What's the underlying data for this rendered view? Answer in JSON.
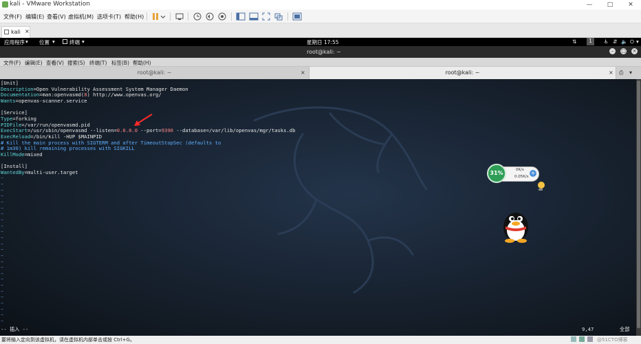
{
  "vmware": {
    "window_title": "kali - VMware Workstation",
    "menus": [
      "文件(F)",
      "编辑(E)",
      "查看(V)",
      "虚拟机(M)",
      "选项卡(T)",
      "帮助(H)"
    ],
    "tab_label": "kali",
    "status_hint": "要将输入定向到该虚拟机，请在虚拟机内部单击或按 Ctrl+G。"
  },
  "kali": {
    "topbar": {
      "applications": "应用程序",
      "places": "位置",
      "terminal": "终端",
      "clock": "星期日 17:55",
      "workspace": "1"
    },
    "terminal_window": {
      "title": "root@kali: ~",
      "menus": [
        "文件(F)",
        "编辑(E)",
        "查看(V)",
        "搜索(S)",
        "终端(T)",
        "标签(B)",
        "帮助(H)"
      ],
      "tabs": [
        "root@kali: ~",
        "root@kali: ~"
      ],
      "tab_close": "×"
    },
    "editor": {
      "lines": [
        {
          "k": "[Unit]",
          "v": ""
        },
        {
          "k": "Description",
          "v": "=Open Vulnerability Assessment System Manager Daemon"
        },
        {
          "k": "Documentation",
          "v": "=man:openvasmd(8) http://www.openvas.org/"
        },
        {
          "k": "Wants",
          "v": "=openvas-scanner.service"
        },
        {
          "k": "",
          "v": ""
        },
        {
          "k": "[Service]",
          "v": ""
        },
        {
          "k": "Type",
          "v": "=forking"
        },
        {
          "k": "PIDFile",
          "v": "=/var/run/openvasmd.pid"
        },
        {
          "k": "ExecStart",
          "v": "=/usr/sbin/openvasmd --listen=0.0.0.0 --port=9390 --database=/var/lib/openvas/mgr/tasks.db"
        },
        {
          "k": "ExecReload",
          "v": "=/bin/kill -HUP $MAINPID"
        },
        {
          "k": "# Kill the main process with SIGTERM and after TimeoutStopSec (defaults to",
          "v": ""
        },
        {
          "k": "# 1m30) kill remaining processes with SIGKILL",
          "v": ""
        },
        {
          "k": "KillMode",
          "v": "=mixed"
        },
        {
          "k": "",
          "v": ""
        },
        {
          "k": "[Install]",
          "v": ""
        },
        {
          "k": "WantedBy",
          "v": "=multi-user.target"
        }
      ],
      "tilde": "~",
      "mode": "-- 插入 --",
      "cursor_pos": "9,47",
      "scroll": "全部"
    },
    "netmon": {
      "percent": "31%",
      "up": "0K/s",
      "down": "0.05K/s"
    }
  },
  "watermark": "@51CTO博客"
}
